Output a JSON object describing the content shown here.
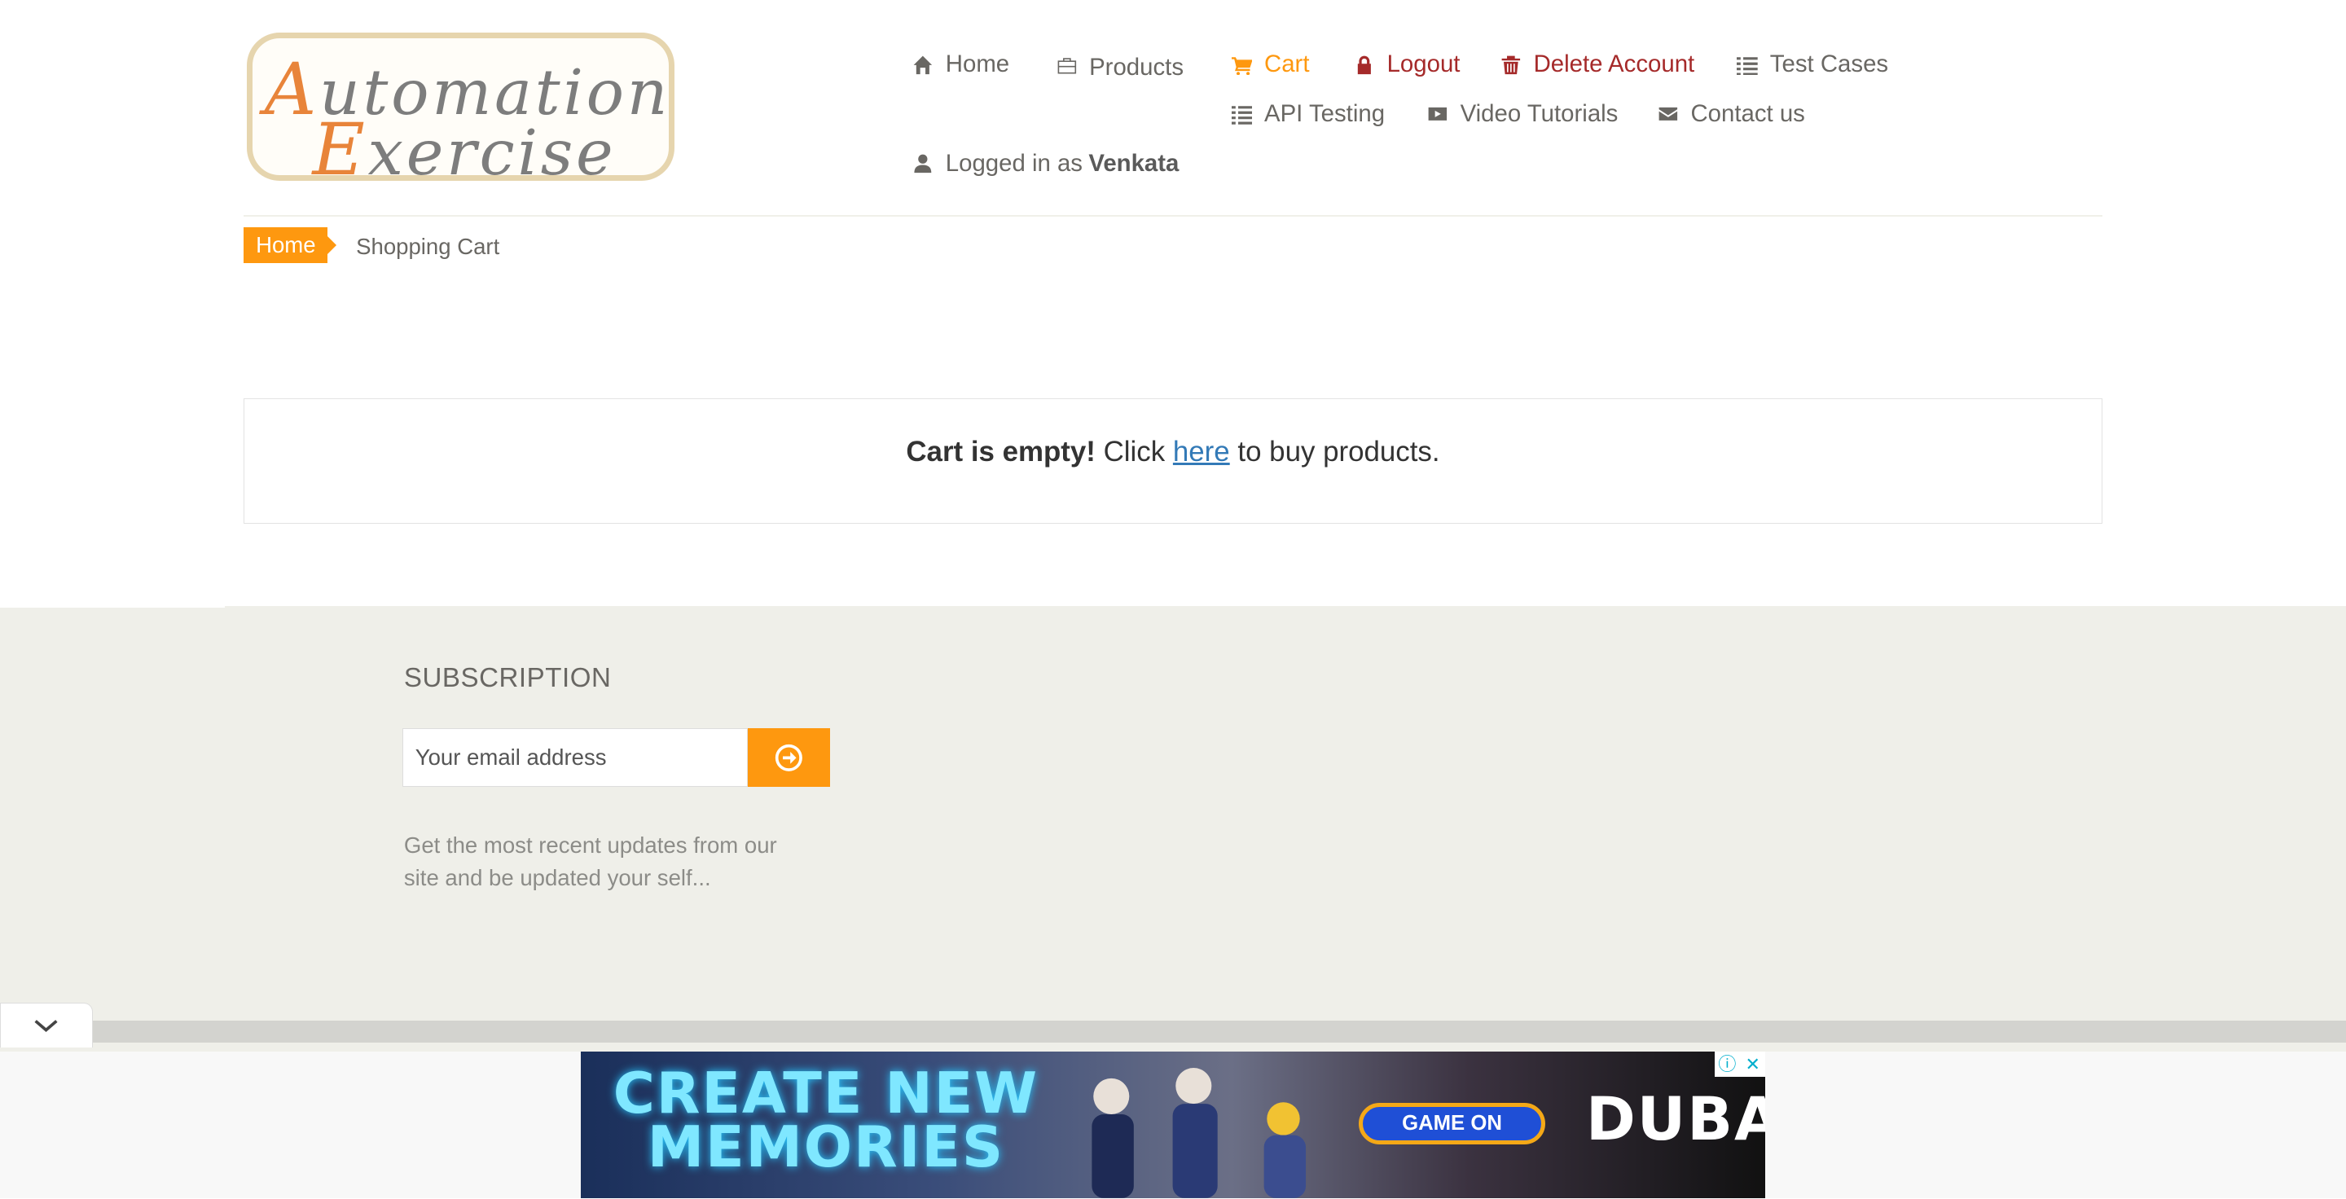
{
  "logo": {
    "line1_cap": "A",
    "line1_rest": "utomation",
    "line2_cap": "E",
    "line2_rest": "xercise"
  },
  "nav": {
    "home": "Home",
    "products": "Products",
    "cart": "Cart",
    "logout": "Logout",
    "delete_account": "Delete Account",
    "test_cases": "Test Cases",
    "api_testing": "API Testing",
    "video_tutorials": "Video Tutorials",
    "contact_us": "Contact us",
    "logged_in_prefix": "Logged in as",
    "username": "Venkata"
  },
  "breadcrumb": {
    "home": "Home",
    "current": "Shopping Cart"
  },
  "cart": {
    "empty_bold": "Cart is empty!",
    "click": "Click",
    "link": "here",
    "suffix": "to buy products."
  },
  "footer": {
    "subscription_title": "SUBSCRIPTION",
    "email_placeholder": "Your email address",
    "description": "Get the most recent updates from our site and be updated your self..."
  },
  "ad": {
    "headline_1": "CREATE NEW",
    "headline_2": "MEMORIES",
    "button": "GAME ON",
    "brand": "DUBAI",
    "info_icon": "ⓘ",
    "close_icon": "✕"
  },
  "colors": {
    "accent": "#FE980F",
    "danger": "#A52A2A",
    "link": "#337AB7",
    "footer_bg": "#EFEFE9"
  }
}
